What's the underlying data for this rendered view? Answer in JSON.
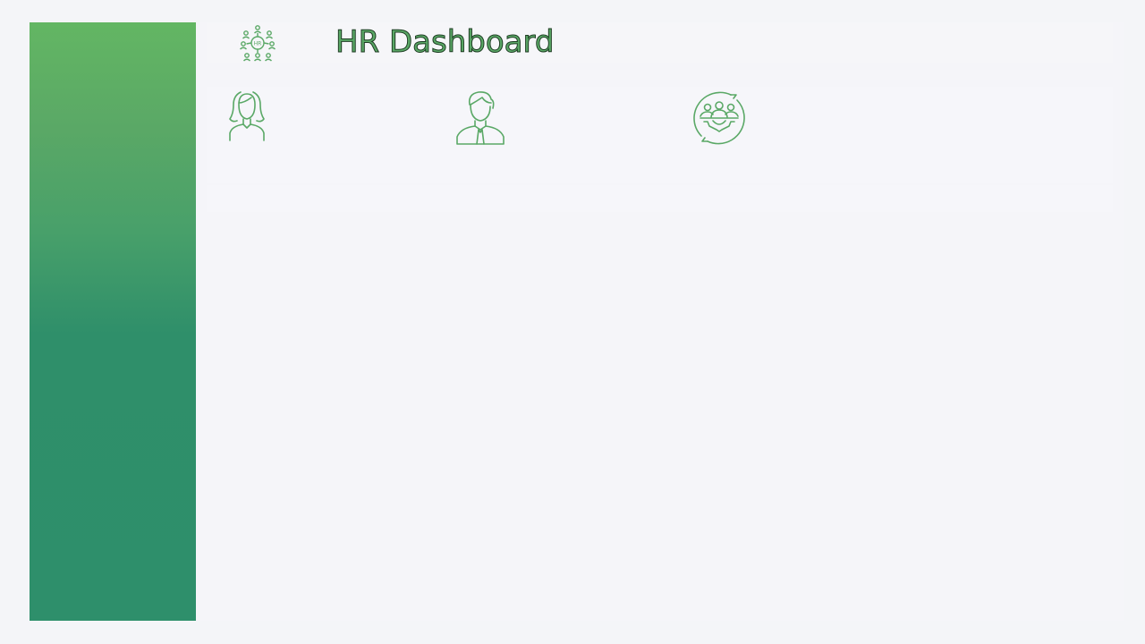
{
  "header": {
    "title": "HR Dashboard",
    "logo_icon": "hr-network-icon"
  },
  "cards": [
    {
      "icon": "female-employee-icon"
    },
    {
      "icon": "male-employee-icon"
    },
    {
      "icon": "team-cycle-icon"
    }
  ],
  "colors": {
    "accent": "#5aa866",
    "sidebar_top": "#63b663",
    "sidebar_bottom": "#2e8f6b",
    "background": "#f4f5f8"
  }
}
